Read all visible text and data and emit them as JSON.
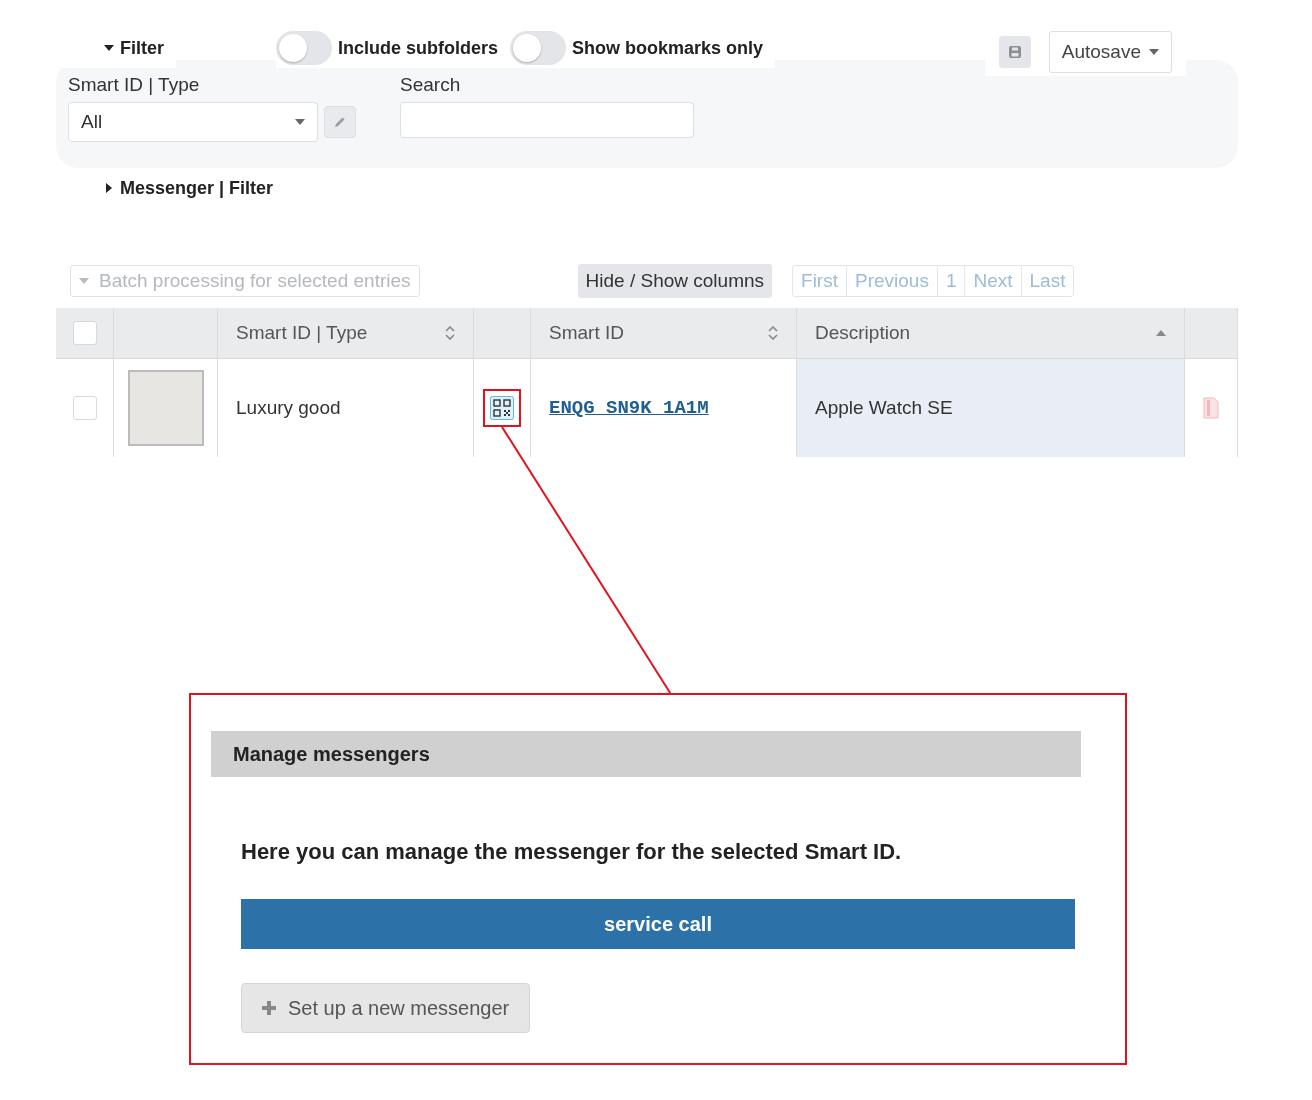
{
  "filter": {
    "title": "Filter",
    "expanded": true,
    "toggles": [
      {
        "label": "Include subfolders",
        "on": false
      },
      {
        "label": "Show bookmarks only",
        "on": false
      }
    ],
    "autosave": "Autosave",
    "fields": [
      {
        "kind": "select",
        "label": "Smart ID | Type",
        "value": "All"
      },
      {
        "kind": "text",
        "label": "Search"
      }
    ]
  },
  "messenger_filter": {
    "title": "Messenger | Filter",
    "expanded": false
  },
  "toolbar": {
    "batch": {
      "label": "Batch processing for selected entries",
      "disabled": true
    },
    "columns_button": "Hide / Show columns",
    "pager": [
      "First",
      "Previous",
      "1",
      "Next",
      "Last"
    ]
  },
  "table": {
    "columns": [
      {
        "kind": "check",
        "checked": false
      },
      {
        "kind": "image"
      },
      {
        "kind": "text",
        "label": "Smart ID | Type",
        "sortable": true,
        "sorted": false
      },
      {
        "kind": "qr"
      },
      {
        "kind": "text",
        "label": "Smart ID",
        "sortable": true,
        "sorted": false
      },
      {
        "kind": "text",
        "label": "Description",
        "sortable": true,
        "sorted": true
      },
      {
        "kind": "action"
      }
    ],
    "rows": [
      {
        "checked": false,
        "type": "Luxury good",
        "smart_id": "ENQG SN9K 1A1M",
        "description": "Apple Watch SE"
      }
    ]
  },
  "callout": {
    "title": "Manage messengers",
    "text": "Here you can manage the messenger for the selected Smart ID.",
    "primary_button": "service call",
    "secondary_button": "Set up a new messenger"
  }
}
